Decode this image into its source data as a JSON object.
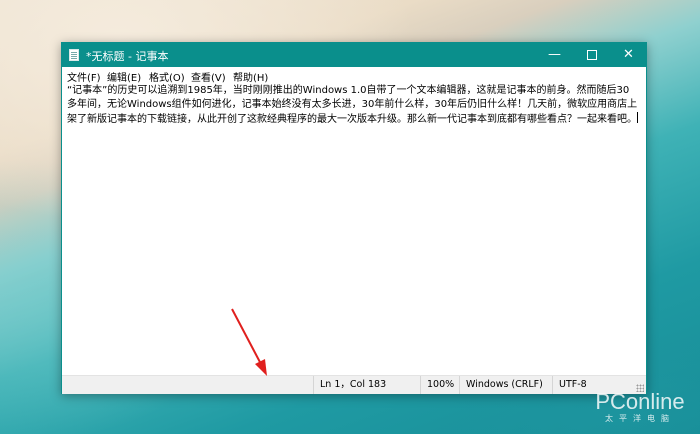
{
  "window": {
    "title": "*无标题 - 记事本",
    "controls": {
      "minimize": "—",
      "close": "✕"
    }
  },
  "menu": {
    "items": [
      "文件(F)",
      "编辑(E)",
      "格式(O)",
      "查看(V)",
      "帮助(H)"
    ]
  },
  "editor": {
    "content": "“记事本”的历史可以追溯到1985年，当时刚刚推出的Windows 1.0自带了一个文本编辑器，这就是记事本的前身。然而随后30多年间，无论Windows组件如何进化，记事本始终没有太多长进，30年前什么样，30年后仍旧什么样！几天前，微软应用商店上架了新版记事本的下载链接，从此开创了这款经典程序的最大一次版本升级。那么新一代记事本到底都有哪些看点？一起来看吧。"
  },
  "status": {
    "position": "Ln 1，Col 183",
    "zoom": "100%",
    "line_ending": "Windows (CRLF)",
    "encoding": "UTF-8"
  },
  "watermark": {
    "brand": "PConline",
    "sub": "太平洋电脑"
  },
  "colors": {
    "titlebar": "#0a8f8c",
    "arrow": "#e0201e"
  }
}
